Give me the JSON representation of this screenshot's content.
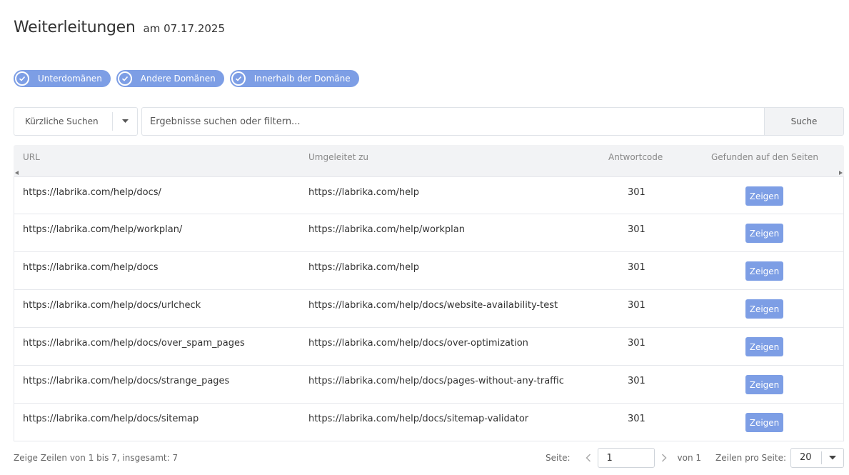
{
  "header": {
    "title": "Weiterleitungen",
    "date": "am 07.17.2025"
  },
  "filters": [
    {
      "label": "Unterdomänen",
      "checked": true
    },
    {
      "label": "Andere Domänen",
      "checked": true
    },
    {
      "label": "Innerhalb der Domäne",
      "checked": true
    }
  ],
  "search": {
    "recent_label": "Kürzliche Suchen",
    "placeholder": "Ergebnisse suchen oder filtern...",
    "button_label": "Suche"
  },
  "table": {
    "columns": {
      "url": "URL",
      "redirect": "Umgeleitet zu",
      "code": "Antwortcode",
      "found": "Gefunden auf den Seiten"
    },
    "show_label": "Zeigen",
    "rows": [
      {
        "url": "https://labrika.com/help/docs/",
        "redirect": "https://labrika.com/help",
        "code": "301"
      },
      {
        "url": "https://labrika.com/help/workplan/",
        "redirect": "https://labrika.com/help/workplan",
        "code": "301"
      },
      {
        "url": "https://labrika.com/help/docs",
        "redirect": "https://labrika.com/help",
        "code": "301"
      },
      {
        "url": "https://labrika.com/help/docs/urlcheck",
        "redirect": "https://labrika.com/help/docs/website-availability-test",
        "code": "301"
      },
      {
        "url": "https://labrika.com/help/docs/over_spam_pages",
        "redirect": "https://labrika.com/help/docs/over-optimization",
        "code": "301"
      },
      {
        "url": "https://labrika.com/help/docs/strange_pages",
        "redirect": "https://labrika.com/help/docs/pages-without-any-traffic",
        "code": "301"
      },
      {
        "url": "https://labrika.com/help/docs/sitemap",
        "redirect": "https://labrika.com/help/docs/sitemap-validator",
        "code": "301"
      }
    ]
  },
  "footer": {
    "info": "Zeige Zeilen von 1 bis 7, insgesamt: 7",
    "page_label": "Seite:",
    "page_value": "1",
    "of_label": "von 1",
    "per_page_label": "Zeilen pro Seite:",
    "per_page_value": "20"
  },
  "colors": {
    "accent": "#7d9ee5",
    "header_bg": "#f2f3f5",
    "border": "#e6e8ec"
  }
}
